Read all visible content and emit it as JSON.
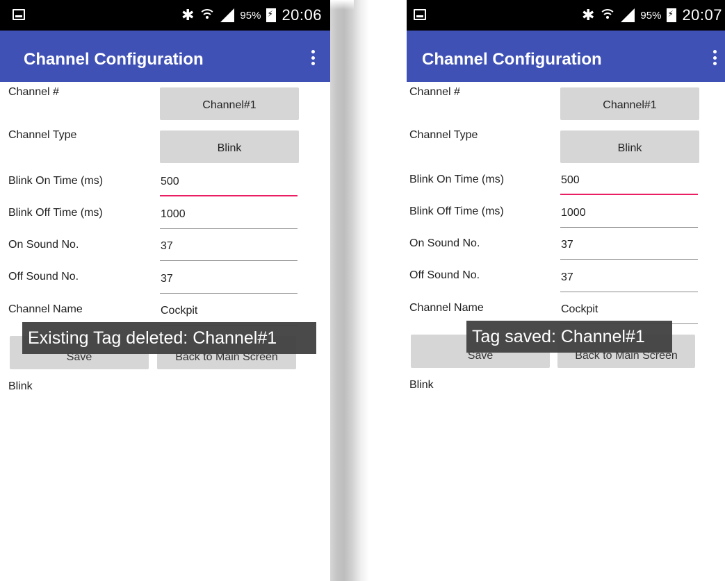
{
  "screens": [
    {
      "status": {
        "battery": "95%",
        "time": "20:06"
      },
      "title": "Channel Configuration",
      "channel_label": "Channel #",
      "channel_value": "Channel#1",
      "type_label": "Channel Type",
      "type_value": "Blink",
      "on_time_label": "Blink On Time (ms)",
      "on_time_value": "500",
      "off_time_label": "Blink Off Time (ms)",
      "off_time_value": "1000",
      "on_sound_label": "On Sound No.",
      "on_sound_value": "37",
      "off_sound_label": "Off Sound No.",
      "off_sound_value": "37",
      "name_label": "Channel Name",
      "name_value": "Cockpit",
      "save_label": "Save",
      "back_label": "Back to Main Screen",
      "status_text": "Blink",
      "toast": "Existing Tag deleted: Channel#1"
    },
    {
      "status": {
        "battery": "95%",
        "time": "20:07"
      },
      "title": "Channel Configuration",
      "channel_label": "Channel #",
      "channel_value": "Channel#1",
      "type_label": "Channel Type",
      "type_value": "Blink",
      "on_time_label": "Blink On Time (ms)",
      "on_time_value": "500",
      "off_time_label": "Blink Off Time (ms)",
      "off_time_value": "1000",
      "on_sound_label": "On Sound No.",
      "on_sound_value": "37",
      "off_sound_label": "Off Sound No.",
      "off_sound_value": "37",
      "name_label": "Channel Name",
      "name_value": "Cockpit",
      "save_label": "Save",
      "back_label": "Back to Main Screen",
      "status_text": "Blink",
      "toast": "Tag saved: Channel#1"
    }
  ],
  "colors": {
    "appbar": "#3f51b5",
    "statusbar": "#000000",
    "button": "#d6d6d6",
    "focus_underline": "#e91e63",
    "toast_bg": "#404040"
  },
  "icons": [
    "screenshot-icon",
    "bluetooth-icon",
    "wifi-icon",
    "signal-icon",
    "battery-icon",
    "overflow-menu-icon"
  ]
}
